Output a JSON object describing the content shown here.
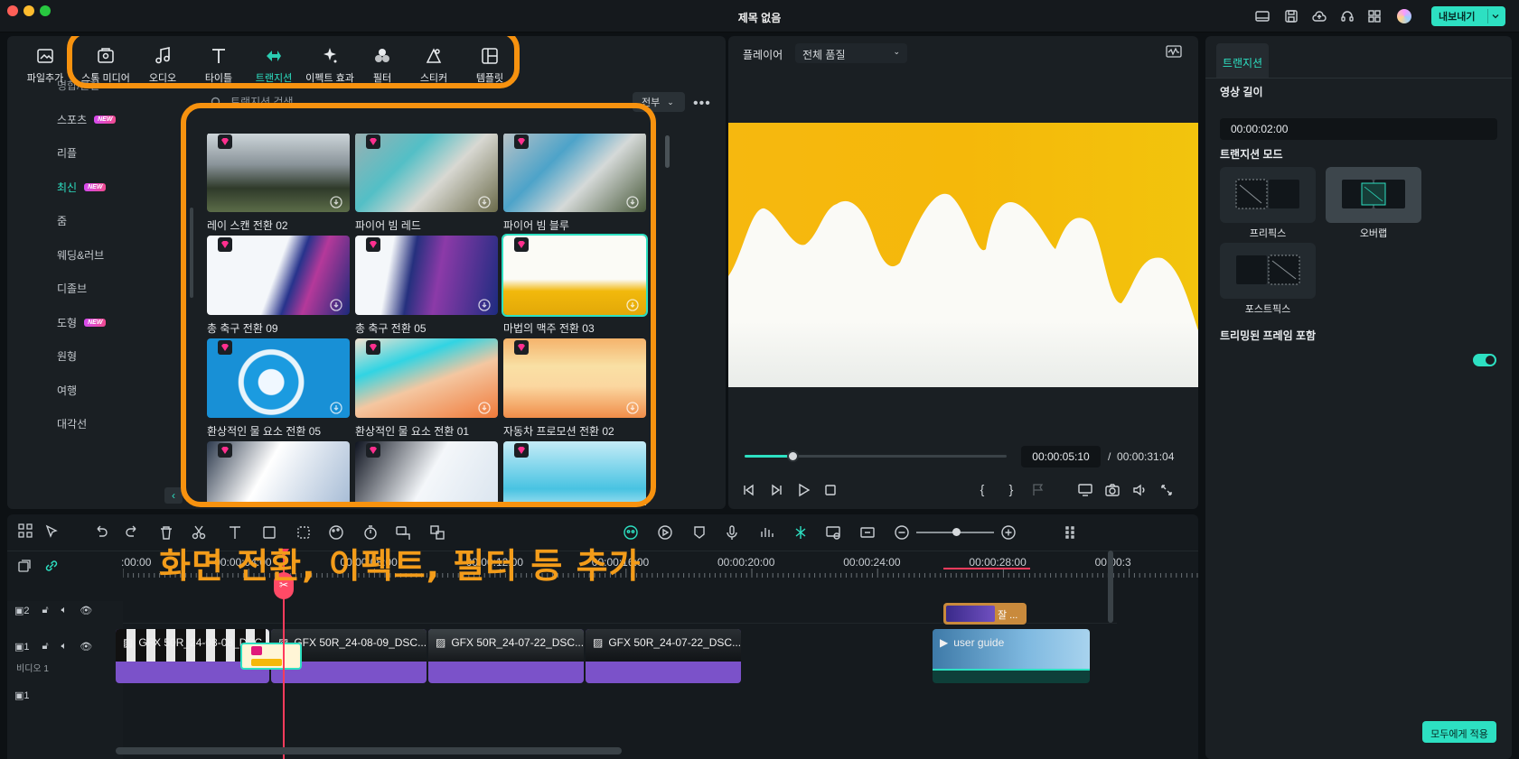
{
  "window": {
    "title": "제목 없음",
    "export_label": "내보내기"
  },
  "library": {
    "tools": [
      {
        "label": "파일추가",
        "icon": "import-icon"
      },
      {
        "label": "스톡 미디어",
        "icon": "stock-media-icon"
      },
      {
        "label": "오디오",
        "icon": "music-note-icon"
      },
      {
        "label": "타이틀",
        "icon": "text-t-icon"
      },
      {
        "label": "트랜지션",
        "icon": "transition-icon"
      },
      {
        "label": "이펙트 효과",
        "icon": "effects-sparkle-icon"
      },
      {
        "label": "필터",
        "icon": "filter-circles-icon"
      },
      {
        "label": "스티커",
        "icon": "sticker-icon"
      },
      {
        "label": "템플릿",
        "icon": "template-icon"
      }
    ],
    "categories": [
      {
        "label": "명합/분할",
        "new": false
      },
      {
        "label": "스포츠",
        "new": true
      },
      {
        "label": "리플",
        "new": false
      },
      {
        "label": "최신",
        "new": true
      },
      {
        "label": "줌",
        "new": false
      },
      {
        "label": "웨딩&러브",
        "new": false
      },
      {
        "label": "디졸브",
        "new": false
      },
      {
        "label": "도형",
        "new": true
      },
      {
        "label": "원형",
        "new": false
      },
      {
        "label": "여행",
        "new": false
      },
      {
        "label": "대각선",
        "new": false
      }
    ],
    "new_badge": "NEW",
    "search_placeholder": "트랜지션 검색",
    "filter_value": "전부",
    "items": [
      {
        "label": "레이 스캔 전환 02"
      },
      {
        "label": "파이어 빔 레드"
      },
      {
        "label": "파이어 빔 블루"
      },
      {
        "label": "총 축구 전환 09"
      },
      {
        "label": "총 축구 전환 05"
      },
      {
        "label": "마법의 맥주 전환 03"
      },
      {
        "label": "환상적인 물 요소 전환 05"
      },
      {
        "label": "환상적인 물 요소 전환 01"
      },
      {
        "label": "자동차 프로모션 전환 02"
      },
      {
        "label": ""
      },
      {
        "label": ""
      },
      {
        "label": ""
      }
    ]
  },
  "player": {
    "label": "플레이어",
    "quality": "전체 품질",
    "current_time": "00:00:05:10",
    "separator": "/",
    "total_time": "00:00:31:04",
    "progress": 0.17
  },
  "properties": {
    "tab": "트랜지션",
    "duration_label": "영상 길이",
    "duration_value": "00:00:02:00",
    "mode_label": "트랜지션 모드",
    "modes": [
      {
        "label": "프리픽스",
        "selected": false
      },
      {
        "label": "오버랩",
        "selected": true
      },
      {
        "label": "포스트픽스",
        "selected": false
      }
    ],
    "trimmed_label": "트리밍된 프레임 포함",
    "trimmed_on": true,
    "apply_all": "모두에게 적용"
  },
  "timeline": {
    "ruler": [
      ":00:00",
      "00:00:04:00",
      "00:00:08:00",
      "00:00:12:00",
      "00:00:16:00",
      "00:00:20:00",
      "00:00:24:00",
      "00:00:28:00",
      "00:00:3"
    ],
    "tracks": [
      {
        "index": "2"
      },
      {
        "index": "1",
        "name": "비디오 1"
      }
    ],
    "clips": [
      {
        "label": "GFX 50R_24-08-08_DSC..."
      },
      {
        "label": "GFX 50R_24-08-09_DSC..."
      },
      {
        "label": "GFX 50R_24-07-22_DSC..."
      },
      {
        "label": "GFX 50R_24-07-22_DSC..."
      },
      {
        "label": "user guide"
      }
    ],
    "upper_clip_label": "잘 ..."
  },
  "caption": "화면 전환, 이펙트, 필터 등 추가",
  "colors": {
    "accent": "#2de0c2",
    "highlight": "#f7920f",
    "clip": "#7b52c9",
    "playhead": "#ff3b5c"
  }
}
